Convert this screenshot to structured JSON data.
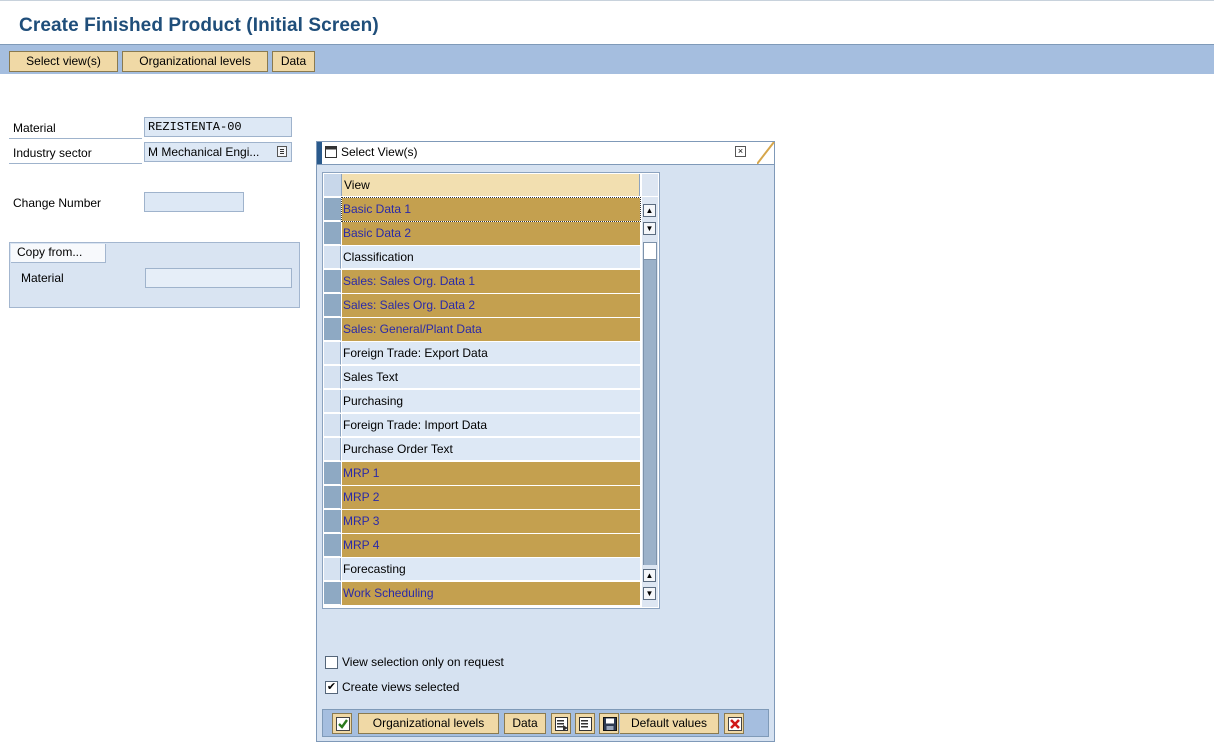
{
  "page": {
    "title": "Create Finished Product (Initial Screen)"
  },
  "toolbar": {
    "select_views": "Select view(s)",
    "org_levels": "Organizational levels",
    "data": "Data"
  },
  "form": {
    "material_label": "Material",
    "material_value": "REZISTENTA-00",
    "industry_label": "Industry sector",
    "industry_value": "M Mechanical Engi...",
    "change_number_label": "Change Number",
    "change_number_value": ""
  },
  "copy_from": {
    "title": "Copy from...",
    "material_label": "Material",
    "material_value": ""
  },
  "dialog": {
    "title": "Select View(s)",
    "column_header": "View",
    "views": [
      {
        "label": "Basic Data 1",
        "selected": true
      },
      {
        "label": "Basic Data 2",
        "selected": true
      },
      {
        "label": "Classification",
        "selected": false
      },
      {
        "label": "Sales: Sales Org. Data 1",
        "selected": true
      },
      {
        "label": "Sales: Sales Org. Data 2",
        "selected": true
      },
      {
        "label": "Sales: General/Plant Data",
        "selected": true
      },
      {
        "label": "Foreign Trade: Export Data",
        "selected": false
      },
      {
        "label": "Sales Text",
        "selected": false
      },
      {
        "label": "Purchasing",
        "selected": false
      },
      {
        "label": "Foreign Trade: Import Data",
        "selected": false
      },
      {
        "label": "Purchase Order Text",
        "selected": false
      },
      {
        "label": "MRP 1",
        "selected": true
      },
      {
        "label": "MRP 2",
        "selected": true
      },
      {
        "label": "MRP 3",
        "selected": true
      },
      {
        "label": "MRP 4",
        "selected": true
      },
      {
        "label": "Forecasting",
        "selected": false
      },
      {
        "label": "Work Scheduling",
        "selected": true
      }
    ],
    "opt_view_on_request": {
      "label": "View selection only on request",
      "checked": false
    },
    "opt_create_selected": {
      "label": "Create views selected",
      "checked": true
    },
    "buttons": {
      "org_levels": "Organizational levels",
      "data": "Data",
      "default_values": "Default values"
    },
    "icons": [
      "checkmark-icon",
      "select-all-icon",
      "deselect-all-icon",
      "save-icon",
      "cancel-icon"
    ]
  },
  "colors": {
    "selected_row": "#c4a04f",
    "selected_text": "#2a2aa8",
    "toolbar_bg": "#a5bedf",
    "button_bg": "#f0d9a6",
    "title_color": "#1f4e7a"
  }
}
